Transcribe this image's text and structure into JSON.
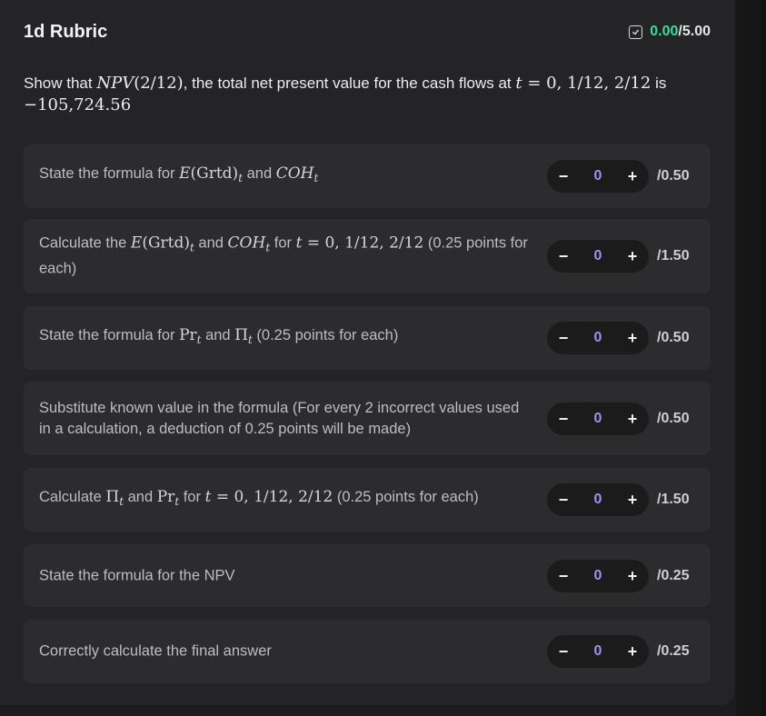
{
  "header": {
    "title": "1d Rubric",
    "score_earned": "0.00",
    "score_total": "/5.00",
    "colors": {
      "earned": "#3ddc97",
      "accent": "#9d93f0"
    }
  },
  "question": {
    "p1": "Show that ",
    "npv": "NPV",
    "npv_arg": "(2/12)",
    "p2": ", the total net present value for the cash flows at ",
    "t": "t",
    "t_vals": " = 0, 1/12, 2/12",
    "p3": " is",
    "value": "−105,724.56"
  },
  "items": [
    {
      "parts": [
        {
          "t": "State the formula for ",
          "k": "txt"
        },
        {
          "t": "E",
          "k": "m"
        },
        {
          "t": "(Grtd)",
          "k": "mr"
        },
        {
          "t": "t",
          "k": "sub"
        },
        {
          "t": " and ",
          "k": "txt"
        },
        {
          "t": "COH",
          "k": "m"
        },
        {
          "t": "t",
          "k": "sub"
        }
      ],
      "value": "0",
      "minus": "−",
      "plus": "+",
      "max": "/0.50"
    },
    {
      "parts": [
        {
          "t": "Calculate the ",
          "k": "txt"
        },
        {
          "t": "E",
          "k": "m"
        },
        {
          "t": "(Grtd)",
          "k": "mr"
        },
        {
          "t": "t",
          "k": "sub"
        },
        {
          "t": " and ",
          "k": "txt"
        },
        {
          "t": "COH",
          "k": "m"
        },
        {
          "t": "t",
          "k": "sub"
        },
        {
          "t": " for ",
          "k": "txt"
        },
        {
          "t": "t",
          "k": "m"
        },
        {
          "t": " = 0, 1/12, 2/12",
          "k": "mr"
        },
        {
          "t": " (0.25 points for each)",
          "k": "txt"
        }
      ],
      "value": "0",
      "minus": "−",
      "plus": "+",
      "max": "/1.50"
    },
    {
      "parts": [
        {
          "t": "State the formula for ",
          "k": "txt"
        },
        {
          "t": "Pr",
          "k": "mr"
        },
        {
          "t": "t",
          "k": "sub"
        },
        {
          "t": " and ",
          "k": "txt"
        },
        {
          "t": "Π",
          "k": "mr"
        },
        {
          "t": "t",
          "k": "sub"
        },
        {
          "t": " (0.25 points for each)",
          "k": "txt"
        }
      ],
      "value": "0",
      "minus": "−",
      "plus": "+",
      "max": "/0.50"
    },
    {
      "parts": [
        {
          "t": "Substitute known value in the formula (For every 2 incorrect values used in a calculation, a deduction of 0.25 points will be made)",
          "k": "txt"
        }
      ],
      "value": "0",
      "minus": "−",
      "plus": "+",
      "max": "/0.50"
    },
    {
      "parts": [
        {
          "t": "Calculate ",
          "k": "txt"
        },
        {
          "t": "Π",
          "k": "mr"
        },
        {
          "t": "t",
          "k": "sub"
        },
        {
          "t": " and ",
          "k": "txt"
        },
        {
          "t": "Pr",
          "k": "mr"
        },
        {
          "t": "t",
          "k": "sub"
        },
        {
          "t": " for ",
          "k": "txt"
        },
        {
          "t": "t",
          "k": "m"
        },
        {
          "t": " = 0, 1/12, 2/12",
          "k": "mr"
        },
        {
          "t": " (0.25 points for each)",
          "k": "txt"
        }
      ],
      "value": "0",
      "minus": "−",
      "plus": "+",
      "max": "/1.50"
    },
    {
      "parts": [
        {
          "t": "State the formula for the NPV",
          "k": "txt"
        }
      ],
      "value": "0",
      "minus": "−",
      "plus": "+",
      "max": "/0.25"
    },
    {
      "parts": [
        {
          "t": "Correctly calculate the final answer",
          "k": "txt"
        }
      ],
      "value": "0",
      "minus": "−",
      "plus": "+",
      "max": "/0.25"
    }
  ]
}
